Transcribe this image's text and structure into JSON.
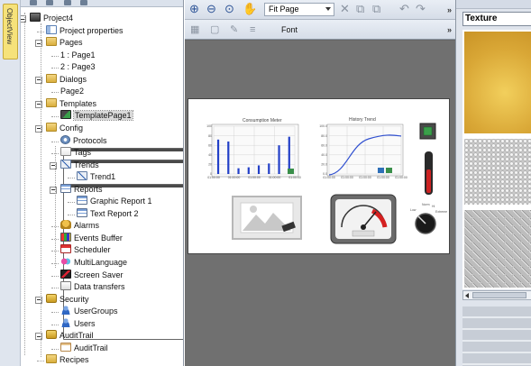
{
  "left_tab": {
    "label": "ObjectView"
  },
  "tree": {
    "items": [
      {
        "label": "Project4",
        "icon": "project-icon",
        "depth": 0,
        "expander": true
      },
      {
        "label": "Project properties",
        "icon": "properties-icon",
        "depth": 1,
        "expander": false
      },
      {
        "label": "Pages",
        "icon": "folder-icon",
        "depth": 1,
        "expander": true
      },
      {
        "label": "1 : Page1",
        "icon": "page-icon",
        "depth": 2,
        "expander": false
      },
      {
        "label": "2 : Page3",
        "icon": "page-icon",
        "depth": 2,
        "expander": false
      },
      {
        "label": "Dialogs",
        "icon": "folder-icon",
        "depth": 1,
        "expander": true
      },
      {
        "label": "Page2",
        "icon": "page-icon",
        "depth": 2,
        "expander": false
      },
      {
        "label": "Templates",
        "icon": "folder-icon",
        "depth": 1,
        "expander": true
      },
      {
        "label": "TemplatePage1",
        "icon": "template-page-icon",
        "depth": 2,
        "expander": false,
        "selected": true
      },
      {
        "label": "Config",
        "icon": "folder-icon",
        "depth": 1,
        "expander": true
      },
      {
        "label": "Protocols",
        "icon": "protocols-icon",
        "depth": 2,
        "expander": false
      },
      {
        "label": "Tags",
        "icon": "tags-icon",
        "depth": 2,
        "expander": false
      },
      {
        "label": "Trends",
        "icon": "trend-icon",
        "depth": 2,
        "expander": true
      },
      {
        "label": "Trend1",
        "icon": "trend-icon",
        "depth": 3,
        "expander": false
      },
      {
        "label": "Reports",
        "icon": "report-icon",
        "depth": 2,
        "expander": true
      },
      {
        "label": "Graphic Report 1",
        "icon": "report-icon",
        "depth": 3,
        "expander": false
      },
      {
        "label": "Text Report 2",
        "icon": "report-icon",
        "depth": 3,
        "expander": false
      },
      {
        "label": "Alarms",
        "icon": "alarm-icon",
        "depth": 2,
        "expander": false
      },
      {
        "label": "Events Buffer",
        "icon": "events-buffer-icon",
        "depth": 2,
        "expander": false
      },
      {
        "label": "Scheduler",
        "icon": "scheduler-icon",
        "depth": 2,
        "expander": false
      },
      {
        "label": "MultiLanguage",
        "icon": "multilanguage-icon",
        "depth": 2,
        "expander": false
      },
      {
        "label": "Screen Saver",
        "icon": "screen-saver-icon",
        "depth": 2,
        "expander": false
      },
      {
        "label": "Data transfers",
        "icon": "data-transfers-icon",
        "depth": 2,
        "expander": false
      },
      {
        "label": "Security",
        "icon": "lock-icon",
        "depth": 1,
        "expander": true
      },
      {
        "label": "UserGroups",
        "icon": "user-icon",
        "depth": 2,
        "expander": false
      },
      {
        "label": "Users",
        "icon": "user-icon",
        "depth": 2,
        "expander": false
      },
      {
        "label": "AuditTrail",
        "icon": "lock-icon",
        "depth": 1,
        "expander": true
      },
      {
        "label": "AuditTrail",
        "icon": "audit-icon",
        "depth": 2,
        "expander": false
      },
      {
        "label": "Recipes",
        "icon": "folder-icon",
        "depth": 1,
        "expander": false
      }
    ]
  },
  "toolbar": {
    "zoom_value": "Fit Page",
    "font_label": "Font",
    "more_label": "»"
  },
  "widgets": {
    "bar_chart": {
      "title": "Consumption Meter",
      "y_ticks": [
        "100",
        "80",
        "60",
        "40",
        "20",
        "0"
      ],
      "x_ticks": [
        "01:00:00",
        "01:00:00",
        "01:00:00",
        "01:00:00",
        "01:00:00"
      ],
      "values": [
        72,
        68,
        12,
        14,
        18,
        22,
        60,
        78
      ]
    },
    "trend_chart": {
      "title": "History Trend",
      "y_ticks": [
        "100.0",
        "80.0",
        "60.0",
        "40.0",
        "20.0",
        "0.0"
      ],
      "x_ticks": [
        "01:00:00",
        "01:00:00",
        "01:00:00",
        "01:00:00",
        "01:00:00"
      ]
    },
    "knob": {
      "labels": [
        "Low",
        "Norm",
        "Hi",
        "Extreme"
      ]
    }
  },
  "texture_panel": {
    "selected": "Texture"
  },
  "colors": {
    "bar": "#2340c8",
    "trend_line": "#3050d0",
    "selection": "#d9d9d9",
    "gold_texture": "#e0b040"
  }
}
